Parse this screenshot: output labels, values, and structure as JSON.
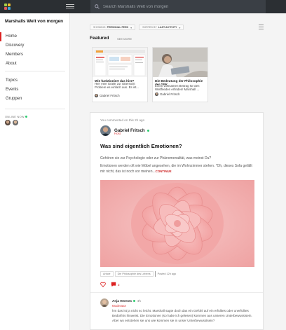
{
  "colors": {
    "topbar": "#2b2f33",
    "accent_red": "#d22222",
    "online_green": "#2ecc71",
    "logo": [
      "#a8cf45",
      "#f2c12e",
      "#e25c5c",
      "#3fa4d9"
    ]
  },
  "header": {
    "search_placeholder": "Search Marshalls Welt von morgen",
    "search_icon": "search-icon",
    "menu_icon": "hamburger-icon"
  },
  "sidebar": {
    "title": "Marshalls Welt von morgen",
    "primary": [
      {
        "label": "Home",
        "active": true
      },
      {
        "label": "Discovery"
      },
      {
        "label": "Members"
      },
      {
        "label": "About"
      }
    ],
    "secondary": [
      {
        "label": "Topics"
      },
      {
        "label": "Events"
      },
      {
        "label": "Gruppen"
      }
    ],
    "online_label": "ONLINE NOW"
  },
  "feed": {
    "filter_showing_prefix": "SHOWING",
    "filter_showing_value": "PERSONAL FEED",
    "filter_sorted_prefix": "SORTED BY",
    "filter_sorted_value": "LAST ACTIVITY",
    "featured_label": "Featured",
    "see_more": "SEE MORE",
    "featured_cards": [
      {
        "title": "Wie funktioniert das hier?",
        "text": "Hier eine Grafik zur Übersicht Probiere es einfach aus. Es ist...",
        "author": "Gabriel Fritsch"
      },
      {
        "title": "Die Bedeutung der Philosophie der GFK",
        "text": "Einen wirksamen Beitrag für den Weltfrieden erfinden! Marshall ...",
        "author": "Gabriel Fritsch"
      }
    ]
  },
  "post": {
    "activity": "You commented on this 2h ago",
    "author": "Gabriel Fritsch",
    "role": "Host",
    "title": "Was sind eigentlich Emotionen?",
    "paragraph1": "Gehören sie zur Psychologie oder zur Phänomenalität, was meinst Du?",
    "paragraph2": "Emotionen werden oft wie Möbel angesehen, die im Wohnzimmer stehen. \"Oh, dieses Sofa gefällt mir nicht, das ist noch vor meinen...",
    "continue": "CONTINUE",
    "tags": [
      "Article",
      "Die Philosophie des Lebens"
    ],
    "posted": "Posted 12h ago",
    "comment_count": "2",
    "comment": {
      "author": "Anja Hermes",
      "time": "4h",
      "role": "Moderator",
      "text": "hm das ist ja nicht so leicht. Marshall sagte doch das ein Gefühl auf ein erfülltes oder unerfülltes Bedürfnis hinweist. Die Emotionen (so habe ich gelesen) kommen aus unseren Unterbewusstsein. Aber wo entstehen sie uns wie kommen sie in unser Unterbewusstsein?"
    }
  }
}
